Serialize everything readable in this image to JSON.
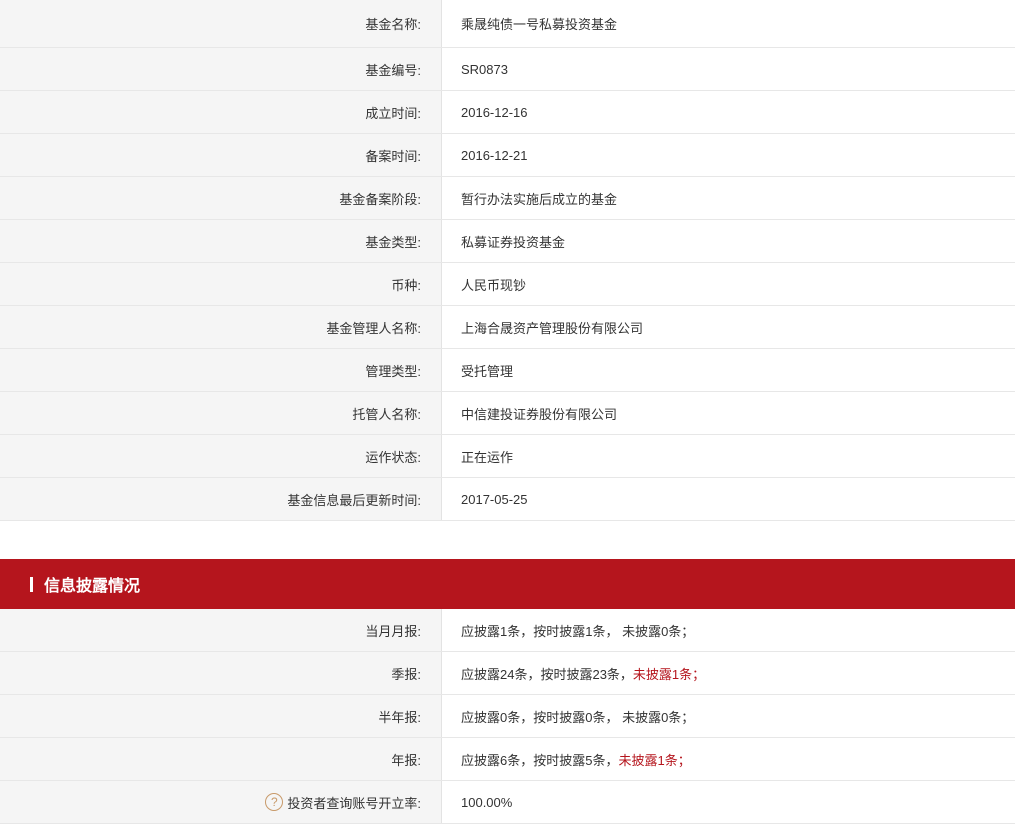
{
  "fund_info": {
    "rows": [
      {
        "label": "基金名称:",
        "value": "乘晟纯债一号私募投资基金"
      },
      {
        "label": "基金编号:",
        "value": "SR0873"
      },
      {
        "label": "成立时间:",
        "value": "2016-12-16"
      },
      {
        "label": "备案时间:",
        "value": "2016-12-21"
      },
      {
        "label": "基金备案阶段:",
        "value": "暂行办法实施后成立的基金"
      },
      {
        "label": "基金类型:",
        "value": "私募证券投资基金"
      },
      {
        "label": "币种:",
        "value": "人民币现钞"
      },
      {
        "label": "基金管理人名称:",
        "value": "上海合晟资产管理股份有限公司"
      },
      {
        "label": "管理类型:",
        "value": "受托管理"
      },
      {
        "label": "托管人名称:",
        "value": "中信建投证券股份有限公司"
      },
      {
        "label": "运作状态:",
        "value": "正在运作"
      },
      {
        "label": "基金信息最后更新时间:",
        "value": "2017-05-25"
      }
    ]
  },
  "disclosure": {
    "title": "信息披露情况",
    "monthly": {
      "label": "当月月报:",
      "text": "应披露1条，按时披露1条， 未披露0条；"
    },
    "quarterly": {
      "label": "季报:",
      "text": "应披露24条，按时披露23条，",
      "missing": "未披露1条；"
    },
    "half_year": {
      "label": "半年报:",
      "text": "应披露0条，按时披露0条， 未披露0条；"
    },
    "annual": {
      "label": "年报:",
      "text": "应披露6条，按时披露5条，",
      "missing": "未披露1条；"
    },
    "investor_rate": {
      "icon": "help-icon",
      "help_glyph": "?",
      "label": "投资者查询账号开立率:",
      "value": "100.00%"
    }
  },
  "colors": {
    "accent": "#b5151d",
    "label_bg": "#f5f5f5",
    "help_icon": "#c89a6a"
  }
}
